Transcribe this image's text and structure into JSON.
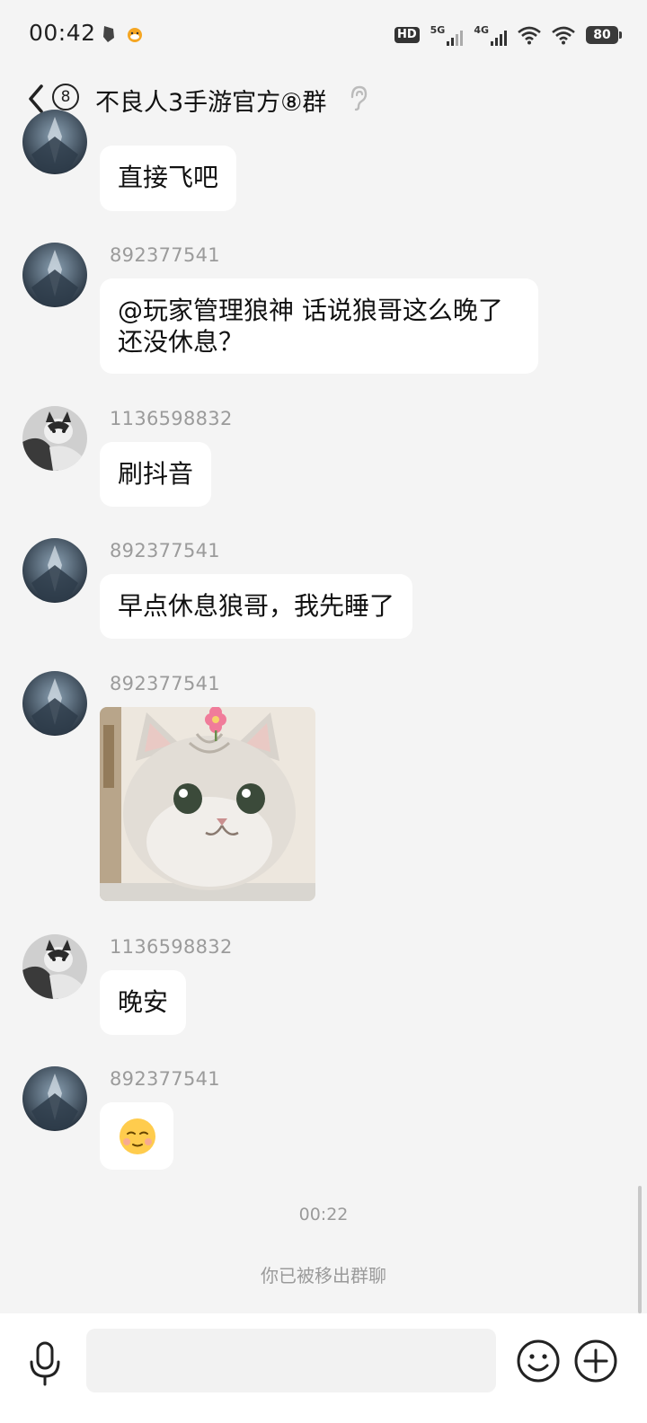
{
  "status_bar": {
    "time": "00:42",
    "hd_label": "HD",
    "net1_label": "5G",
    "net2_label": "4G",
    "battery": "80"
  },
  "header": {
    "unread_count": "8",
    "title": "不良人3手游官方⑧群"
  },
  "messages": [
    {
      "sender": "",
      "text": "直接飞吧"
    },
    {
      "sender": "892377541",
      "text": "@玩家管理狼神 话说狼哥这么晚了还没休息？"
    },
    {
      "sender": "1136598832",
      "text": "刷抖音"
    },
    {
      "sender": "892377541",
      "text": "早点休息狼哥，我先睡了"
    },
    {
      "sender": "892377541",
      "text": ""
    },
    {
      "sender": "1136598832",
      "text": "晚安"
    },
    {
      "sender": "892377541",
      "text": ""
    }
  ],
  "time_divider": "00:22",
  "system_notice": "你已被移出群聊",
  "input": {
    "placeholder": ""
  },
  "colors": {
    "background": "#f4f4f4",
    "bubble": "#ffffff",
    "secondary_text": "#9b9b9b"
  }
}
